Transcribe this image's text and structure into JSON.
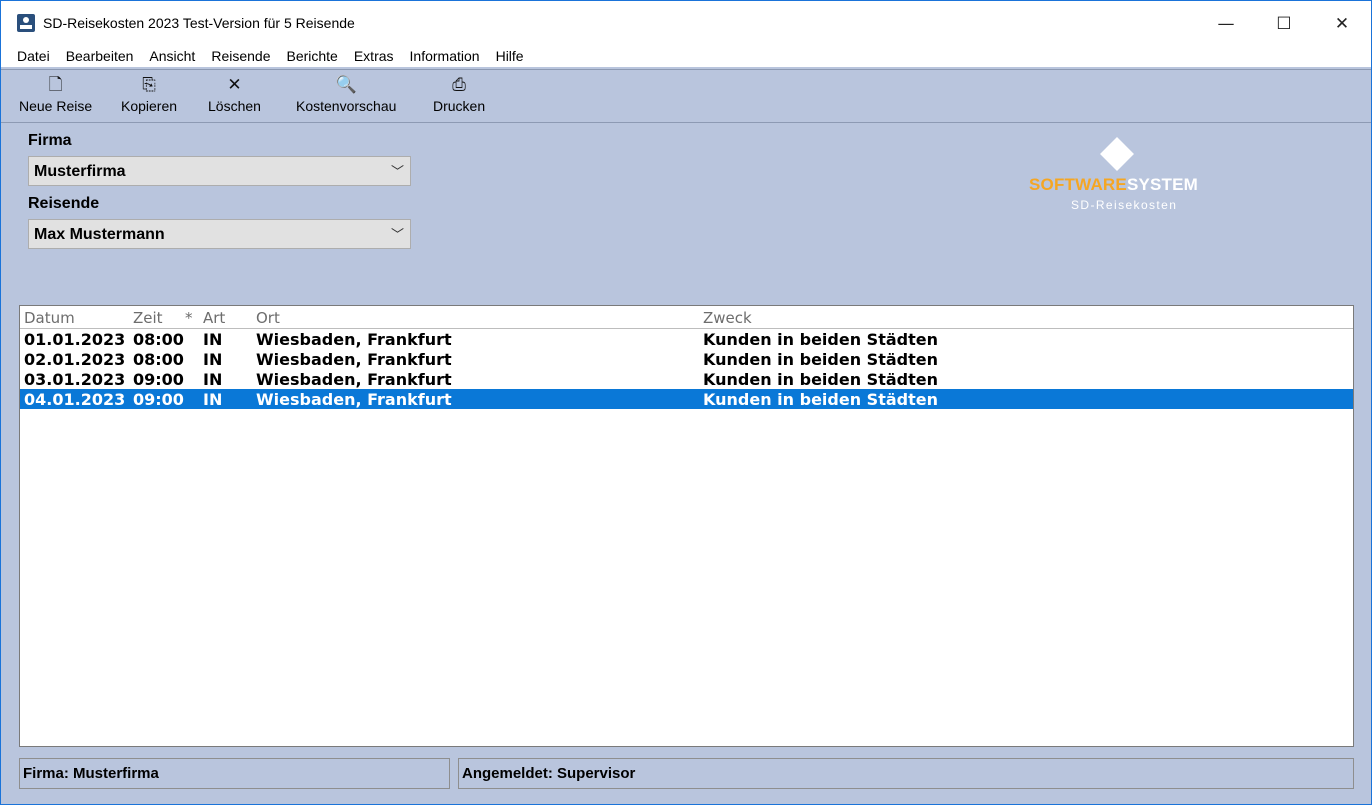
{
  "window": {
    "title": "SD-Reisekosten 2023 Test-Version für 5 Reisende",
    "controls": {
      "minimize": "—",
      "maximize": "☐",
      "close": "✕"
    }
  },
  "menu": [
    "Datei",
    "Bearbeiten",
    "Ansicht",
    "Reisende",
    "Berichte",
    "Extras",
    "Information",
    "Hilfe"
  ],
  "toolbar": {
    "new_trip": {
      "label": "Neue Reise",
      "icon": "new-document-icon",
      "glyph": "🗋"
    },
    "copy": {
      "label": "Kopieren",
      "icon": "copy-icon",
      "glyph": "⎘"
    },
    "delete": {
      "label": "Löschen",
      "icon": "delete-x-icon",
      "glyph": "✕"
    },
    "preview": {
      "label": "Kostenvorschau",
      "icon": "preview-icon",
      "glyph": "🔍"
    },
    "print": {
      "label": "Drucken",
      "icon": "printer-icon",
      "glyph": "⎙"
    }
  },
  "form": {
    "firma_label": "Firma",
    "firma_value": "Musterfirma",
    "reisende_label": "Reisende",
    "reisende_value": "Max Mustermann",
    "chevron": "﹀"
  },
  "logo": {
    "part1": "SOFTWARE",
    "part2": "SYSTEM",
    "subtitle": "SD-Reisekosten",
    "orange": "#f5a623"
  },
  "list": {
    "headers": {
      "datum": "Datum",
      "zeit": "Zeit",
      "star": "*",
      "art": "Art",
      "ort": "Ort",
      "zweck": "Zweck"
    },
    "rows": [
      {
        "datum": "01.01.2023",
        "zeit": "08:00",
        "art": "IN",
        "ort": "Wiesbaden, Frankfurt",
        "zweck": "Kunden in beiden Städten",
        "selected": false
      },
      {
        "datum": "02.01.2023",
        "zeit": "08:00",
        "art": "IN",
        "ort": "Wiesbaden, Frankfurt",
        "zweck": "Kunden in beiden Städten",
        "selected": false
      },
      {
        "datum": "03.01.2023",
        "zeit": "09:00",
        "art": "IN",
        "ort": "Wiesbaden, Frankfurt",
        "zweck": "Kunden in beiden Städten",
        "selected": false
      },
      {
        "datum": "04.01.2023",
        "zeit": "09:00",
        "art": "IN",
        "ort": "Wiesbaden, Frankfurt",
        "zweck": "Kunden in beiden Städten",
        "selected": true
      }
    ],
    "selection_color": "#0a78d7"
  },
  "statusbar": {
    "left": "Firma: Musterfirma",
    "right": "Angemeldet: Supervisor"
  }
}
